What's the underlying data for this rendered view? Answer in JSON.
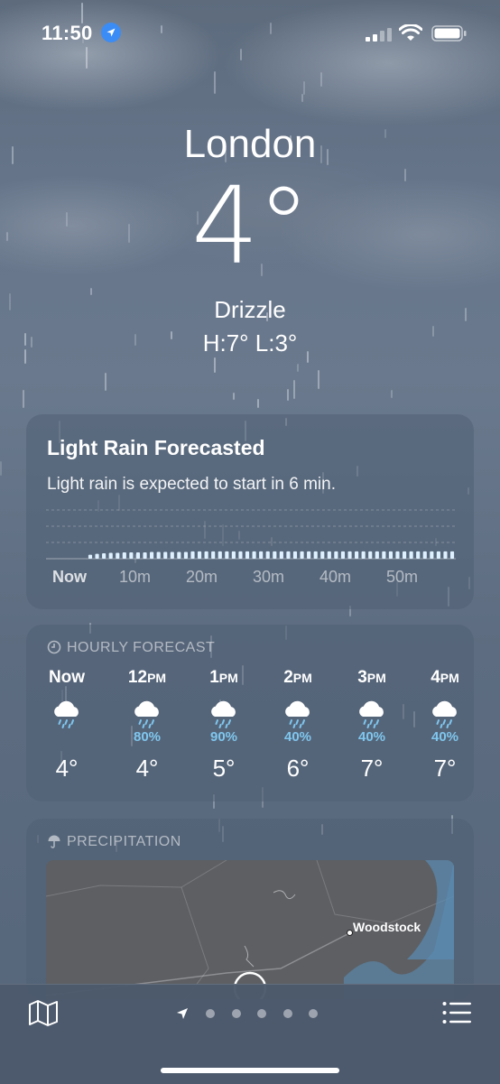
{
  "status_bar": {
    "time": "11:50",
    "icons": [
      "location-arrow-icon",
      "cellular-signal-icon",
      "wifi-icon",
      "battery-icon"
    ]
  },
  "header": {
    "city": "London",
    "temperature": "4°",
    "condition": "Drizzle",
    "high_low": "H:7°  L:3°"
  },
  "rain_card": {
    "title": "Light Rain Forecasted",
    "subtitle": "Light rain is expected to start in 6 min.",
    "ticks": [
      "Now",
      "10m",
      "20m",
      "30m",
      "40m",
      "50m"
    ],
    "chart_data": {
      "type": "bar",
      "xlabel": "",
      "ylabel": "",
      "x_ticks": [
        "Now",
        "10m",
        "20m",
        "30m",
        "40m",
        "50m"
      ],
      "minutes": 60,
      "start_minute": 6,
      "values_relative": [
        0.08,
        0.1,
        0.11,
        0.12,
        0.12,
        0.13,
        0.13,
        0.13,
        0.13,
        0.14,
        0.14,
        0.14,
        0.14,
        0.14,
        0.14,
        0.15,
        0.15,
        0.15,
        0.15,
        0.15,
        0.15,
        0.15,
        0.15,
        0.15,
        0.15,
        0.15,
        0.15,
        0.15,
        0.15,
        0.15,
        0.15,
        0.15,
        0.15,
        0.15,
        0.15,
        0.15,
        0.15,
        0.15,
        0.15,
        0.15,
        0.15,
        0.15,
        0.15,
        0.15,
        0.15,
        0.15,
        0.15,
        0.15,
        0.15,
        0.15,
        0.15,
        0.15,
        0.15,
        0.15
      ],
      "grid": true,
      "bar_color": "#dff1ff"
    }
  },
  "hourly": {
    "header": "HOURLY FORECAST",
    "header_icon": "clock-icon",
    "items": [
      {
        "hour": "Now",
        "suffix": "",
        "icon": "rain-cloud-icon",
        "pop": "",
        "temp": "4°"
      },
      {
        "hour": "12",
        "suffix": "PM",
        "icon": "rain-cloud-icon",
        "pop": "80%",
        "temp": "4°"
      },
      {
        "hour": "1",
        "suffix": "PM",
        "icon": "rain-cloud-icon",
        "pop": "90%",
        "temp": "5°"
      },
      {
        "hour": "2",
        "suffix": "PM",
        "icon": "rain-cloud-icon",
        "pop": "40%",
        "temp": "6°"
      },
      {
        "hour": "3",
        "suffix": "PM",
        "icon": "rain-cloud-icon",
        "pop": "40%",
        "temp": "7°"
      },
      {
        "hour": "4",
        "suffix": "PM",
        "icon": "rain-cloud-icon",
        "pop": "40%",
        "temp": "7°"
      }
    ],
    "pop_color": "#7fc6ee"
  },
  "precipitation": {
    "header": "PRECIPITATION",
    "header_icon": "umbrella-icon",
    "map_place": "Woodstock"
  },
  "toolbar": {
    "left_icon": "map-icon",
    "right_icon": "list-icon",
    "pages": 5,
    "current_icon": "location-arrow-icon"
  }
}
